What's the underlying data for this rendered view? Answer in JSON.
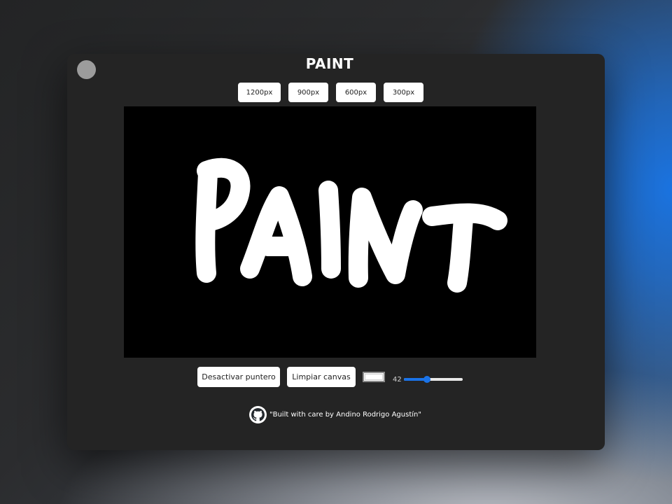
{
  "app": {
    "title": "PAINT"
  },
  "size_buttons": [
    "1200px",
    "900px",
    "600px",
    "300px"
  ],
  "canvas": {
    "background": "#000000",
    "stroke_color": "#ffffff"
  },
  "controls": {
    "pointer_button": "Desactivar puntero",
    "clear_button": "Limpiar canvas",
    "color_value": "#ffffff",
    "brush_size": "42",
    "brush_size_fraction": 0.4
  },
  "footer": {
    "icon": "github-icon",
    "text": "\"Built with care by Andino Rodrigo Agustín\""
  },
  "colors": {
    "window_bg": "#242424",
    "accent": "#1a73e8"
  }
}
